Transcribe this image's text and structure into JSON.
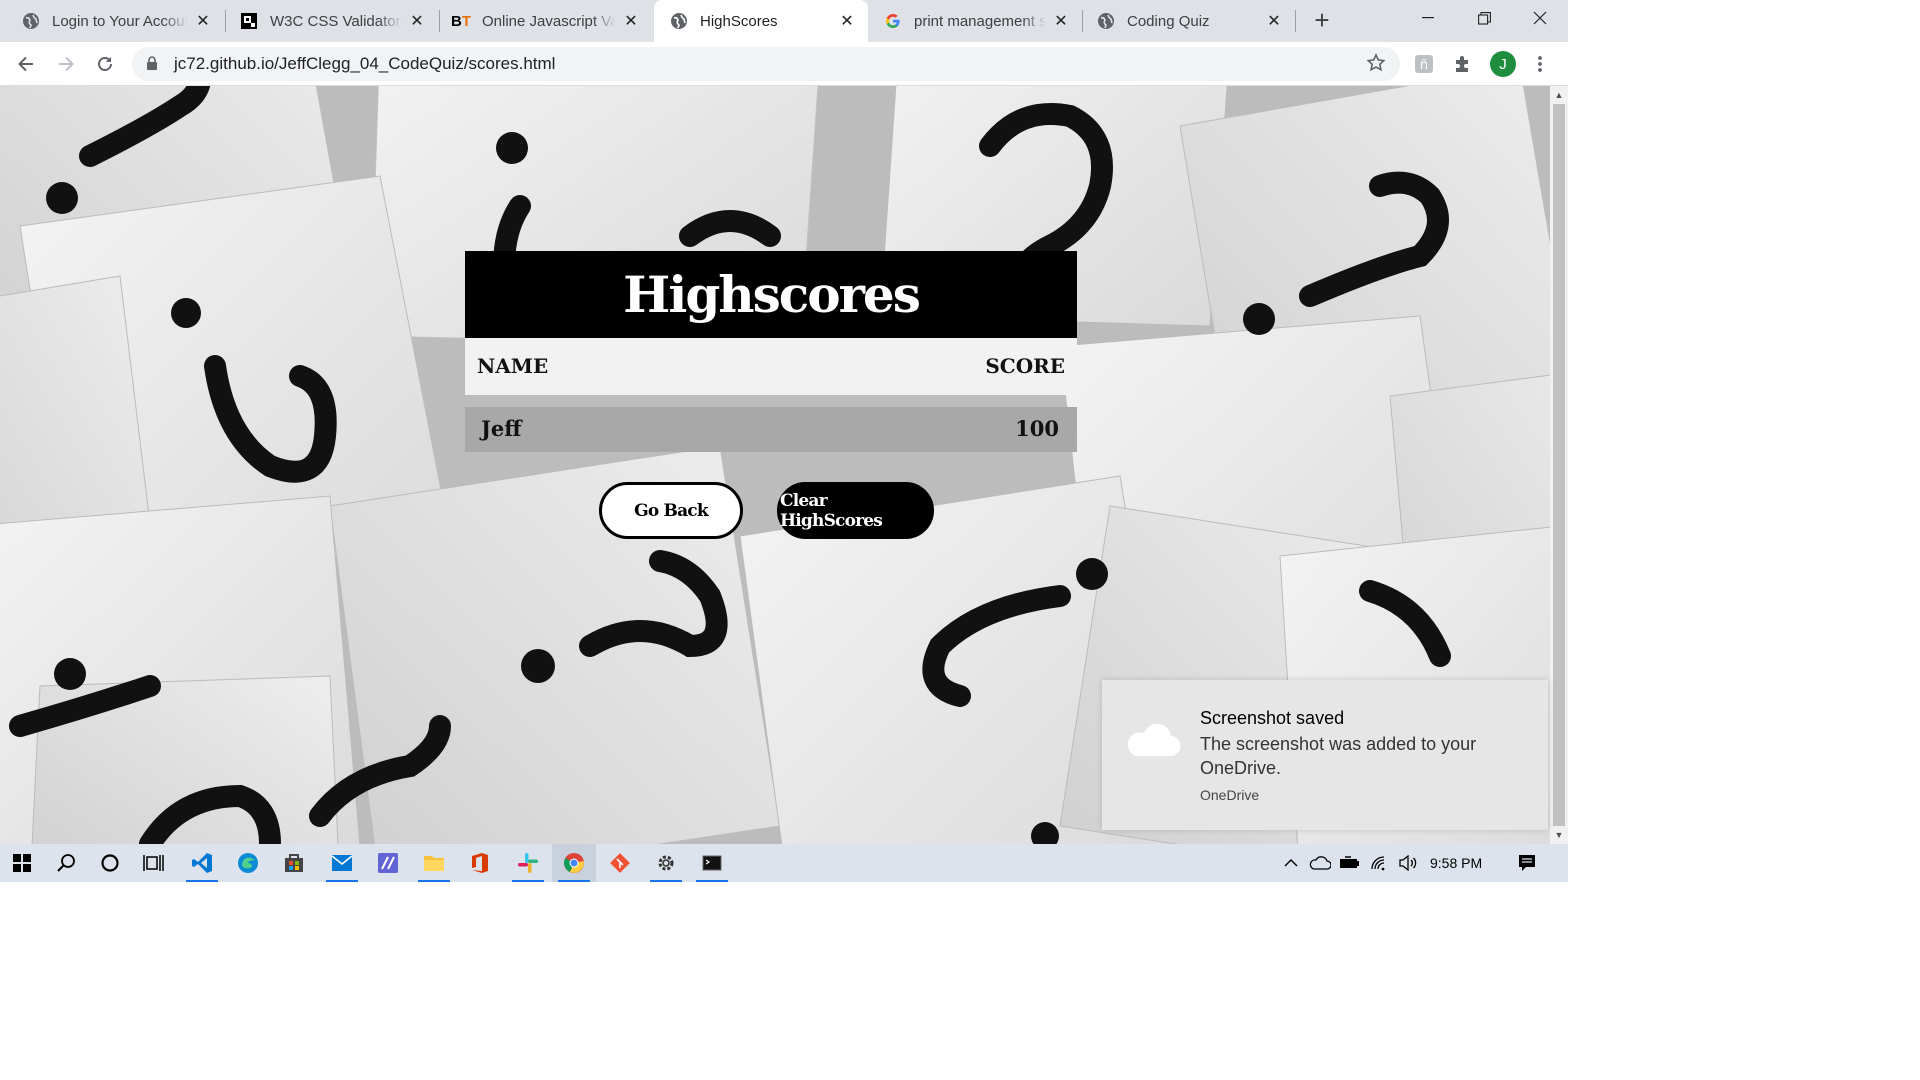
{
  "browser": {
    "tabs": [
      {
        "title": "Login to Your Account",
        "active": false
      },
      {
        "title": "W3C CSS Validator results",
        "active": false
      },
      {
        "title": "Online Javascript Validator",
        "active": false
      },
      {
        "title": "HighScores",
        "active": true
      },
      {
        "title": "print management software",
        "active": false
      },
      {
        "title": "Coding Quiz",
        "active": false
      }
    ],
    "url": "jc72.github.io/JeffClegg_04_CodeQuiz/scores.html",
    "profile_initial": "J"
  },
  "page": {
    "title": "Highscores",
    "columns": {
      "name": "NAME",
      "score": "SCORE"
    },
    "rows": [
      {
        "name": "Jeff",
        "score": "100"
      }
    ],
    "buttons": {
      "back": "Go Back",
      "clear": "Clear HighScores"
    }
  },
  "toast": {
    "title": "Screenshot saved",
    "body": "The screenshot was added to your OneDrive.",
    "source": "OneDrive"
  },
  "taskbar": {
    "time": "9:58 PM"
  },
  "colors": {
    "header_bg": "#000000",
    "row_bg": "#a8a8a8",
    "accent": "#1a73e8"
  }
}
